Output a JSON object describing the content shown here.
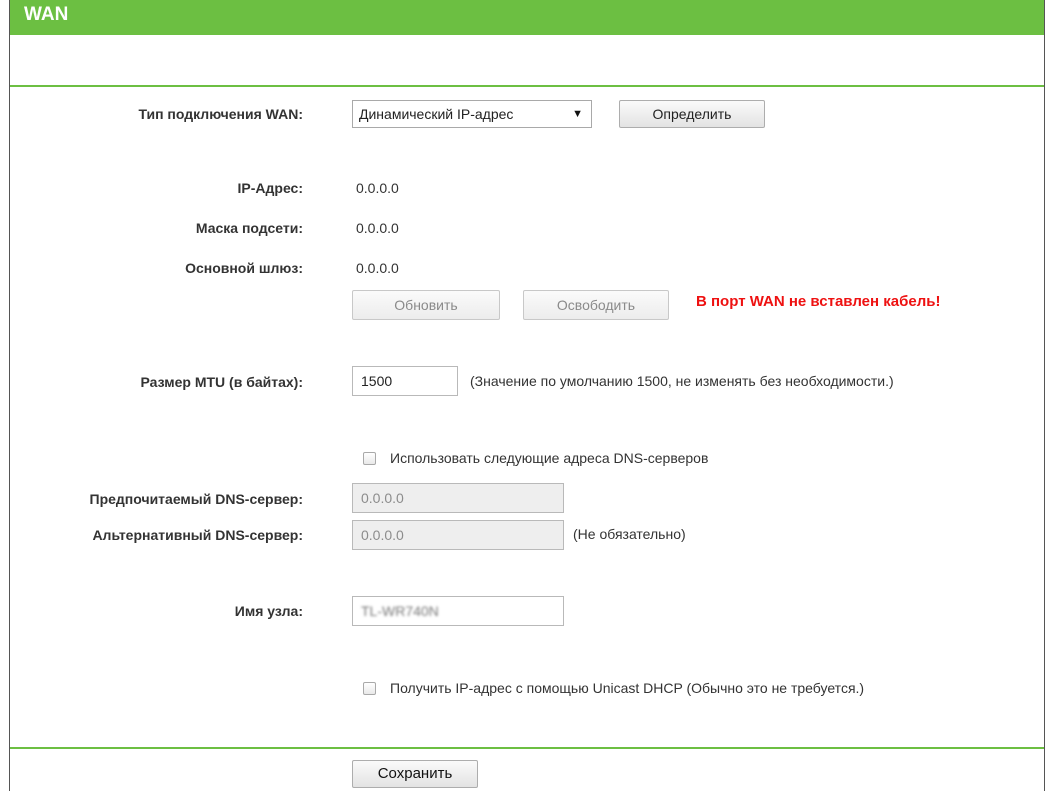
{
  "header": {
    "title": "WAN"
  },
  "form": {
    "conn_type": {
      "label": "Тип подключения WAN:",
      "selected": "Динамический IP-адрес",
      "detect_button": "Определить"
    },
    "ip": {
      "label": "IP-Адрес:",
      "value": "0.0.0.0"
    },
    "mask": {
      "label": "Маска подсети:",
      "value": "0.0.0.0"
    },
    "gateway": {
      "label": "Основной шлюз:",
      "value": "0.0.0.0"
    },
    "renew_button": "Обновить",
    "release_button": "Освободить",
    "error_text": "В порт WAN не вставлен кабель!",
    "mtu": {
      "label": "Размер MTU (в байтах):",
      "value": "1500",
      "hint": "(Значение по умолчанию 1500, не изменять без необходимости.)"
    },
    "use_dns": {
      "label": "Использовать следующие адреса DNS-серверов",
      "checked": false
    },
    "primary_dns": {
      "label": "Предпочитаемый DNS-сервер:",
      "value": "0.0.0.0"
    },
    "secondary_dns": {
      "label": "Альтернативный DNS-сервер:",
      "value": "0.0.0.0",
      "hint": "(Не обязательно)"
    },
    "hostname": {
      "label": "Имя узла:",
      "value": "TL-WR740N"
    },
    "unicast": {
      "label": "Получить IP-адрес с помощью Unicast DHCP (Обычно это не требуется.)",
      "checked": false
    },
    "save_button": "Сохранить"
  },
  "colors": {
    "accent": "#6cbf42",
    "error": "#ee1111"
  }
}
